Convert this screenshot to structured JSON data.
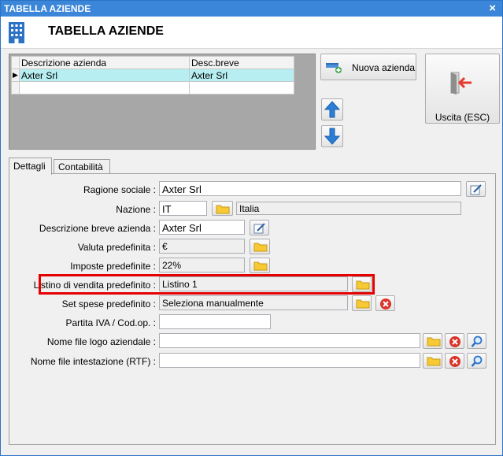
{
  "window": {
    "title": "TABELLA AZIENDE",
    "close_glyph": "×"
  },
  "header": {
    "title": "TABELLA AZIENDE",
    "icon": "building-icon"
  },
  "grid": {
    "columns": [
      "Descrizione azienda",
      "Desc.breve"
    ],
    "rows": [
      {
        "descrizione": "Axter Srl",
        "breve": "Axter Srl",
        "selected": true
      }
    ],
    "row_indicator": "▶"
  },
  "buttons": {
    "nuova_azienda": "Nuova azienda",
    "uscita": "Uscita (ESC)"
  },
  "tabs": [
    {
      "label": "Dettagli",
      "active": true
    },
    {
      "label": "Contabilità",
      "active": false
    }
  ],
  "form": {
    "ragione_sociale": {
      "label": "Ragione sociale :",
      "value": "Axter Srl"
    },
    "nazione": {
      "label": "Nazione :",
      "code": "IT",
      "name": "Italia"
    },
    "descrizione_breve": {
      "label": "Descrizione breve azienda :",
      "value": "Axter Srl"
    },
    "valuta": {
      "label": "Valuta predefinita :",
      "value": "€"
    },
    "imposte": {
      "label": "Imposte predefinite :",
      "value": "22%"
    },
    "listino": {
      "label": "Listino di vendita predefinito :",
      "value": "Listino 1"
    },
    "set_spese": {
      "label": "Set spese predefinito :",
      "value": "Seleziona manualmente"
    },
    "partita_iva": {
      "label": "Partita IVA / Cod.op. :",
      "value": ""
    },
    "logo": {
      "label": "Nome file logo aziendale :",
      "value": ""
    },
    "intestazione": {
      "label": "Nome file intestazione (RTF) :",
      "value": ""
    }
  },
  "colors": {
    "titlebar": "#3b86d8",
    "grid_background": "#a7a7a7",
    "selected_row": "#b6eef2",
    "highlight_border": "#e50000",
    "arrow_blue": "#2b7fd6",
    "folder_yellow": "#f7c935",
    "delete_red": "#d9342b"
  }
}
